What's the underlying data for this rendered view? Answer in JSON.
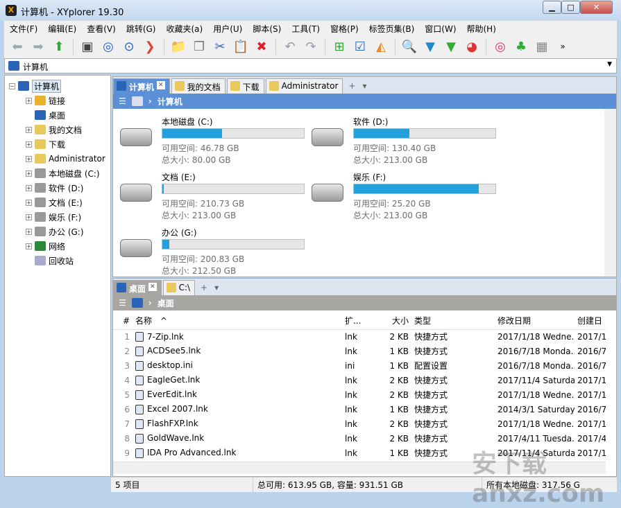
{
  "window": {
    "title": "计算机 - XYplorer 19.30",
    "min": "▁",
    "max": "□",
    "close": "✕"
  },
  "menu": [
    "文件(F)",
    "编辑(E)",
    "查看(V)",
    "跳转(G)",
    "收藏夹(a)",
    "用户(U)",
    "脚本(S)",
    "工具(T)",
    "窗格(P)",
    "标签页集(B)",
    "窗口(W)",
    "帮助(H)"
  ],
  "toolbar": {
    "icons": [
      "back-icon",
      "forward-icon",
      "up-icon",
      "computer-icon",
      "target-icon",
      "search-circle-icon",
      "goto-icon",
      "new-folder-icon",
      "copy-icon",
      "cut-icon",
      "paste-icon",
      "delete-icon",
      "undo-icon",
      "redo-icon",
      "tree-toggle-icon",
      "checkbox-icon",
      "pizza-icon",
      "find-icon",
      "filter-icon",
      "visual-filter-icon",
      "pie-chart-icon",
      "spiral-icon",
      "tree-icon",
      "dual-pane-icon"
    ],
    "more": "»"
  },
  "address": {
    "value": "计算机"
  },
  "tree": [
    {
      "label": "计算机",
      "level": 0,
      "exp": "−"
    },
    {
      "label": "链接",
      "level": 1,
      "exp": "+"
    },
    {
      "label": "桌面",
      "level": 1,
      "exp": ""
    },
    {
      "label": "我的文档",
      "level": 1,
      "exp": "+"
    },
    {
      "label": "下载",
      "level": 1,
      "exp": "+"
    },
    {
      "label": "Administrator",
      "level": 1,
      "exp": "+"
    },
    {
      "label": "本地磁盘 (C:)",
      "level": 1,
      "exp": "+"
    },
    {
      "label": "软件 (D:)",
      "level": 1,
      "exp": "+"
    },
    {
      "label": "文档 (E:)",
      "level": 1,
      "exp": "+"
    },
    {
      "label": "娱乐 (F:)",
      "level": 1,
      "exp": "+"
    },
    {
      "label": "办公 (G:)",
      "level": 1,
      "exp": "+"
    },
    {
      "label": "网络",
      "level": 1,
      "exp": "+"
    },
    {
      "label": "回收站",
      "level": 1,
      "exp": ""
    }
  ],
  "pane1": {
    "tabs": [
      "计算机",
      "我的文档",
      "下载",
      "Administrator"
    ],
    "crumb": "计算机",
    "add": "+",
    "menu": "▾",
    "close": "✕",
    "free_label": "可用空间:",
    "total_label": "总大小:",
    "drives": [
      {
        "name": "本地磁盘 (C:)",
        "free": "46.78 GB",
        "total": "80.00 GB",
        "used_pct": 42
      },
      {
        "name": "软件 (D:)",
        "free": "130.40 GB",
        "total": "213.00 GB",
        "used_pct": 39
      },
      {
        "name": "文档 (E:)",
        "free": "210.73 GB",
        "total": "213.00 GB",
        "used_pct": 1
      },
      {
        "name": "娱乐 (F:)",
        "free": "25.20 GB",
        "total": "213.00 GB",
        "used_pct": 88
      },
      {
        "name": "办公 (G:)",
        "free": "200.83 GB",
        "total": "212.50 GB",
        "used_pct": 5
      }
    ]
  },
  "pane2": {
    "tabs": [
      "桌面",
      "C:\\"
    ],
    "crumb": "桌面",
    "add": "+",
    "menu": "▾",
    "close": "✕",
    "columns": [
      "#",
      "名称",
      "扩...",
      "大小",
      "类型",
      "修改日期",
      "创建日"
    ],
    "rows": [
      [
        "1",
        "7-Zip.lnk",
        "lnk",
        "2 KB",
        "快捷方式",
        "2017/1/18 Wedne...",
        "2017/1"
      ],
      [
        "2",
        "ACDSee5.lnk",
        "lnk",
        "1 KB",
        "快捷方式",
        "2016/7/18 Monda...",
        "2016/7"
      ],
      [
        "3",
        "desktop.ini",
        "ini",
        "1 KB",
        "配置设置",
        "2016/7/18 Monda...",
        "2016/7"
      ],
      [
        "4",
        "EagleGet.lnk",
        "lnk",
        "2 KB",
        "快捷方式",
        "2017/11/4 Saturda...",
        "2017/1"
      ],
      [
        "5",
        "EverEdit.lnk",
        "lnk",
        "2 KB",
        "快捷方式",
        "2017/1/18 Wedne...",
        "2017/1"
      ],
      [
        "6",
        "Excel 2007.lnk",
        "lnk",
        "1 KB",
        "快捷方式",
        "2014/3/1 Saturday...",
        "2016/7"
      ],
      [
        "7",
        "FlashFXP.lnk",
        "lnk",
        "2 KB",
        "快捷方式",
        "2017/1/18 Wedne...",
        "2017/1"
      ],
      [
        "8",
        "GoldWave.lnk",
        "lnk",
        "2 KB",
        "快捷方式",
        "2017/4/11 Tuesda...",
        "2017/4"
      ],
      [
        "9",
        "IDA Pro Advanced.lnk",
        "lnk",
        "1 KB",
        "快捷方式",
        "2017/11/4 Saturda...",
        "2017/1"
      ]
    ]
  },
  "status": {
    "items": "5 项目",
    "space": "总可用: 613.95 GB, 容量: 931.51 GB",
    "drives": "所有本地磁盘: 317.56 G"
  },
  "watermark": "安下载 anxz.com",
  "colors": {
    "accent": "#5b8fd6",
    "bar": "#26a0da",
    "inactive_crumb": "#a8a6a3"
  }
}
